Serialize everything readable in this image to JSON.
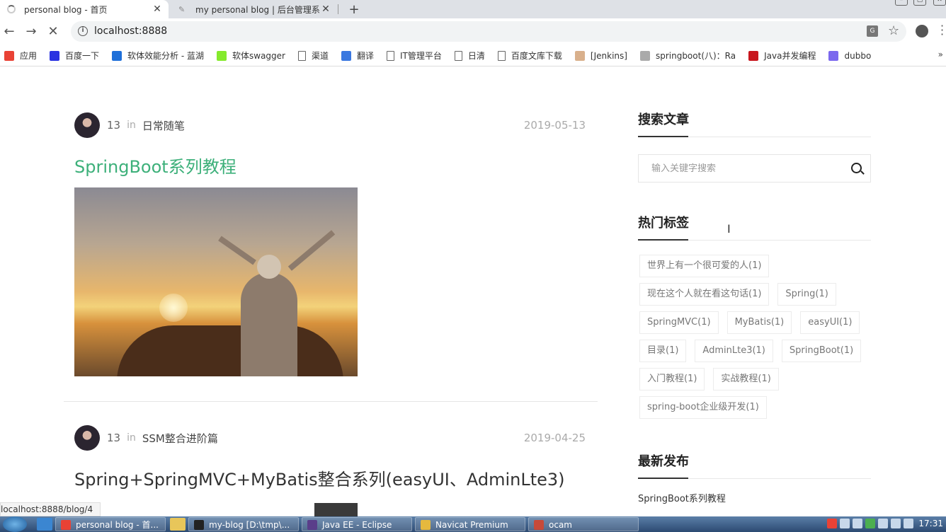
{
  "browser": {
    "tabs": [
      {
        "title": "personal blog - 首页",
        "active": true
      },
      {
        "title": "my personal blog | 后台管理系统",
        "active": false
      }
    ],
    "new_tab": "+",
    "address": "localhost:8888",
    "status_url": "localhost:8888/blog/4"
  },
  "bookmarks": [
    {
      "label": "应用",
      "icon": "apps-icon",
      "color": "#e94235"
    },
    {
      "label": "百度一下",
      "icon": "baidu-paw-icon",
      "color": "#2932e1"
    },
    {
      "label": "软体效能分析 - 蓝湖",
      "icon": "lanhu-icon",
      "color": "#1e6fd9"
    },
    {
      "label": "软体swagger",
      "icon": "swagger-icon",
      "color": "#85ea2d"
    },
    {
      "label": "渠道",
      "icon": "page-icon",
      "color": "#ffffff"
    },
    {
      "label": "翻译",
      "icon": "translate-icon",
      "color": "#3a78e0"
    },
    {
      "label": "IT管理平台",
      "icon": "page-icon",
      "color": "#ffffff"
    },
    {
      "label": "日清",
      "icon": "page-icon",
      "color": "#ffffff"
    },
    {
      "label": "百度文库下载",
      "icon": "page-icon",
      "color": "#ffffff"
    },
    {
      "label": "[Jenkins]",
      "icon": "jenkins-icon",
      "color": "#d9b08c"
    },
    {
      "label": "springboot(八)：Ra",
      "icon": "blog-icon",
      "color": "#aaaaaa"
    },
    {
      "label": "Java并发编程",
      "icon": "csdn-icon",
      "color": "#c8161d"
    },
    {
      "label": "dubbo",
      "icon": "dubbo-icon",
      "color": "#7b68ee"
    }
  ],
  "bookmarks_more": "»",
  "posts": [
    {
      "author": "13",
      "in": "in",
      "category": "日常随笔",
      "date": "2019-05-13",
      "title": "SpringBoot系列教程"
    },
    {
      "author": "13",
      "in": "in",
      "category": "SSM整合进阶篇",
      "date": "2019-04-25",
      "title": "Spring+SpringMVC+MyBatis整合系列(easyUI、AdminLte3)"
    }
  ],
  "sidebar": {
    "search_title": "搜索文章",
    "search_placeholder": "输入关键字搜索",
    "tags_title": "热门标签",
    "tags": [
      "世界上有一个很可爱的人(1)",
      "现在这个人就在看这句话(1)",
      "Spring(1)",
      "SpringMVC(1)",
      "MyBatis(1)",
      "easyUI(1)",
      "目录(1)",
      "AdminLte3(1)",
      "SpringBoot(1)",
      "入门教程(1)",
      "实战教程(1)",
      "spring-boot企业级开发(1)"
    ],
    "latest_title": "最新发布",
    "latest_items": [
      "SpringBoot系列教程"
    ]
  },
  "taskbar": {
    "tasks": [
      "personal blog - 首...",
      "my-blog [D:\\tmp\\...",
      "Java EE - Eclipse",
      "Navicat Premium",
      "ocam"
    ],
    "clock": "17:31"
  },
  "colors": {
    "accent_green": "#3db07a",
    "tab_bar": "#dee1e6",
    "taskbar": "#2c4a72"
  }
}
